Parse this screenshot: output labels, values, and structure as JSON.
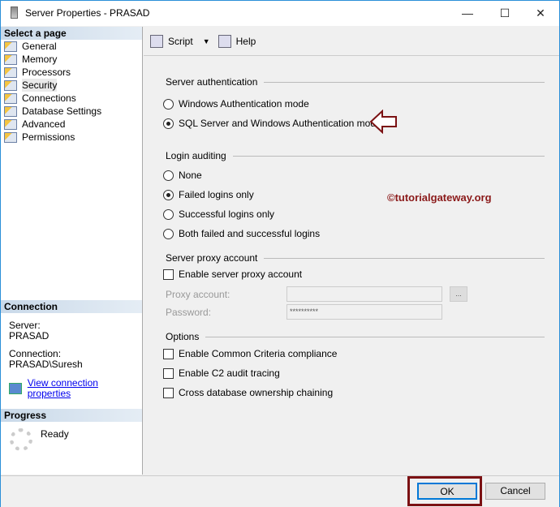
{
  "window": {
    "title": "Server Properties - PRASAD",
    "minimize": "—",
    "maximize": "☐",
    "close": "✕"
  },
  "sidebar": {
    "header": "Select a page",
    "items": [
      {
        "label": "General"
      },
      {
        "label": "Memory"
      },
      {
        "label": "Processors"
      },
      {
        "label": "Security"
      },
      {
        "label": "Connections"
      },
      {
        "label": "Database Settings"
      },
      {
        "label": "Advanced"
      },
      {
        "label": "Permissions"
      }
    ]
  },
  "connection": {
    "header": "Connection",
    "server_label": "Server:",
    "server": "PRASAD",
    "connection_label": "Connection:",
    "connection": "PRASAD\\Suresh",
    "link": "View connection properties"
  },
  "progress": {
    "header": "Progress",
    "status": "Ready"
  },
  "toolbar": {
    "script": "Script",
    "help": "Help"
  },
  "auth": {
    "title": "Server authentication",
    "options": [
      "Windows Authentication mode",
      "SQL Server and Windows Authentication mode"
    ],
    "selected": 1
  },
  "audit": {
    "title": "Login auditing",
    "options": [
      "None",
      "Failed logins only",
      "Successful logins only",
      "Both failed and successful logins"
    ],
    "selected": 1
  },
  "proxy": {
    "title": "Server proxy account",
    "enable": "Enable server proxy account",
    "account_label": "Proxy account:",
    "account_value": "",
    "password_label": "Password:",
    "password_value": "**********",
    "browse": "..."
  },
  "options": {
    "title": "Options",
    "items": [
      "Enable Common Criteria compliance",
      "Enable C2 audit tracing",
      "Cross database ownership chaining"
    ]
  },
  "watermark": "©tutorialgateway.org",
  "buttons": {
    "ok": "OK",
    "cancel": "Cancel"
  },
  "colors": {
    "highlight": "#7b1113",
    "link": "#0000ee"
  }
}
